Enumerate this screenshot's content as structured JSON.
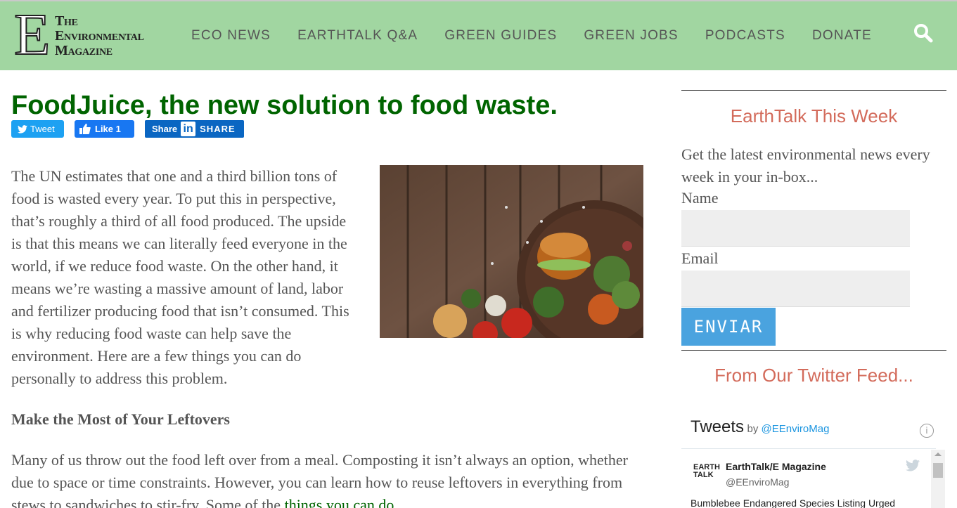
{
  "header": {
    "logo_letter": "E",
    "logo_lines": [
      "The",
      "Environmental",
      "Magazine"
    ],
    "nav": [
      "ECO NEWS",
      "EARTHTALK Q&A",
      "GREEN GUIDES",
      "GREEN JOBS",
      "PODCASTS",
      "DONATE"
    ],
    "search_icon": "search-icon"
  },
  "article": {
    "title": "FoodJuice, the new solution to food waste.",
    "share": {
      "tweet": "Tweet",
      "like": "Like 1",
      "share": "Share",
      "linkedin_in": "in",
      "linkedin_share": "SHARE"
    },
    "para1": "The UN estimates that one and a third billion tons of food is wasted every year. To put this in perspective, that’s roughly a third of all food produced. The upside is that this means we can literally feed everyone in the world, if we reduce food waste. On the other hand, it means we’re wasting a massive amount of land, labor and fertilizer producing food that isn’t consumed. This is why reducing food waste can help save the environment. Here are a few things you can do personally to address this problem.",
    "subhead": "Make the Most of Your Leftovers",
    "para2": "Many of us throw out the food left over from a meal. Composting it isn’t always an option, whether due to space or time constraints. However, you can learn how to reuse leftovers in everything from stews to sandwiches to stir-fry. Some of the ",
    "para2_link": "things you can do"
  },
  "sidebar": {
    "newsletter_heading": "EarthTalk This Week",
    "newsletter_text": "Get the latest environmental news every week in your in-box...",
    "name_label": "Name",
    "email_label": "Email",
    "submit_label": "ENVIAR",
    "twitter_heading": "From Our Twitter Feed...",
    "twitter": {
      "title": "Tweets",
      "by": "by",
      "handle_link": "@EEnviroMag",
      "info": "i",
      "avatar_text": "EARTH TALK",
      "account_name": "EarthTalk/E Magazine",
      "account_handle": "@EEnviroMag",
      "tweet_text": "Bumblebee Endangered Species Listing Urged"
    }
  },
  "colors": {
    "header_bg": "#a1d6a1",
    "title_green": "#006400",
    "sidebar_heading": "#d36b5b",
    "button_blue": "#4aa3df"
  }
}
